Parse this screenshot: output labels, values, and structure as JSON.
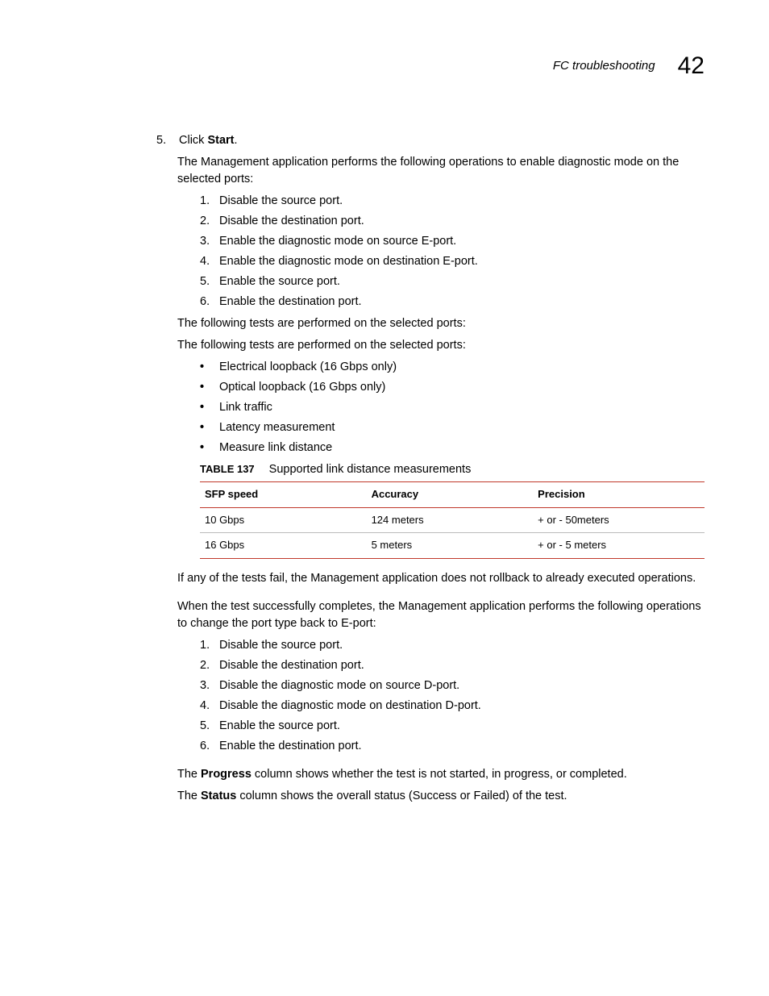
{
  "header": {
    "title": "FC troubleshooting",
    "chapter": "42"
  },
  "step5": {
    "num": "5.",
    "pre": "Click ",
    "bold": "Start",
    "post": "."
  },
  "intro_ops": "The Management application performs the following operations to enable diagnostic mode on the selected ports:",
  "ops_enable": [
    {
      "n": "1.",
      "t": "Disable the source port."
    },
    {
      "n": "2.",
      "t": "Disable the destination port."
    },
    {
      "n": "3.",
      "t": "Enable the diagnostic mode on source E-port."
    },
    {
      "n": "4.",
      "t": "Enable the diagnostic mode on destination E-port."
    },
    {
      "n": "5.",
      "t": "Enable the source port."
    },
    {
      "n": "6.",
      "t": "Enable the destination port."
    }
  ],
  "tests_intro1": "The following tests are performed on the selected ports:",
  "tests_intro2": "The following tests are performed on the selected ports:",
  "tests": [
    "Electrical loopback (16 Gbps only)",
    "Optical loopback (16 Gbps only)",
    "Link traffic",
    "Latency measurement",
    "Measure link distance"
  ],
  "table": {
    "label": "TABLE 137",
    "caption": "Supported link distance measurements",
    "headers": [
      "SFP speed",
      "Accuracy",
      "Precision"
    ],
    "rows": [
      [
        "10 Gbps",
        "124 meters",
        "+ or - 50meters"
      ],
      [
        "16 Gbps",
        "5 meters",
        "+ or - 5 meters"
      ]
    ]
  },
  "fail_note": "If any of the tests fail, the Management application does not rollback to already executed operations.",
  "success_note": "When the test successfully completes, the Management application performs the following operations to change the port type back to E-port:",
  "ops_disable": [
    {
      "n": "1.",
      "t": "Disable the source port."
    },
    {
      "n": "2.",
      "t": "Disable the destination port."
    },
    {
      "n": "3.",
      "t": "Disable the diagnostic mode on source D-port."
    },
    {
      "n": "4.",
      "t": "Disable the diagnostic mode on destination D-port."
    },
    {
      "n": "5.",
      "t": "Enable the source port."
    },
    {
      "n": "6.",
      "t": "Enable the destination port."
    }
  ],
  "progress": {
    "pre": "The ",
    "bold": "Progress",
    "post": " column shows whether the test is not started, in progress, or completed."
  },
  "status": {
    "pre": "The ",
    "bold": "Status",
    "post": " column shows the overall status (Success or Failed) of the test."
  }
}
